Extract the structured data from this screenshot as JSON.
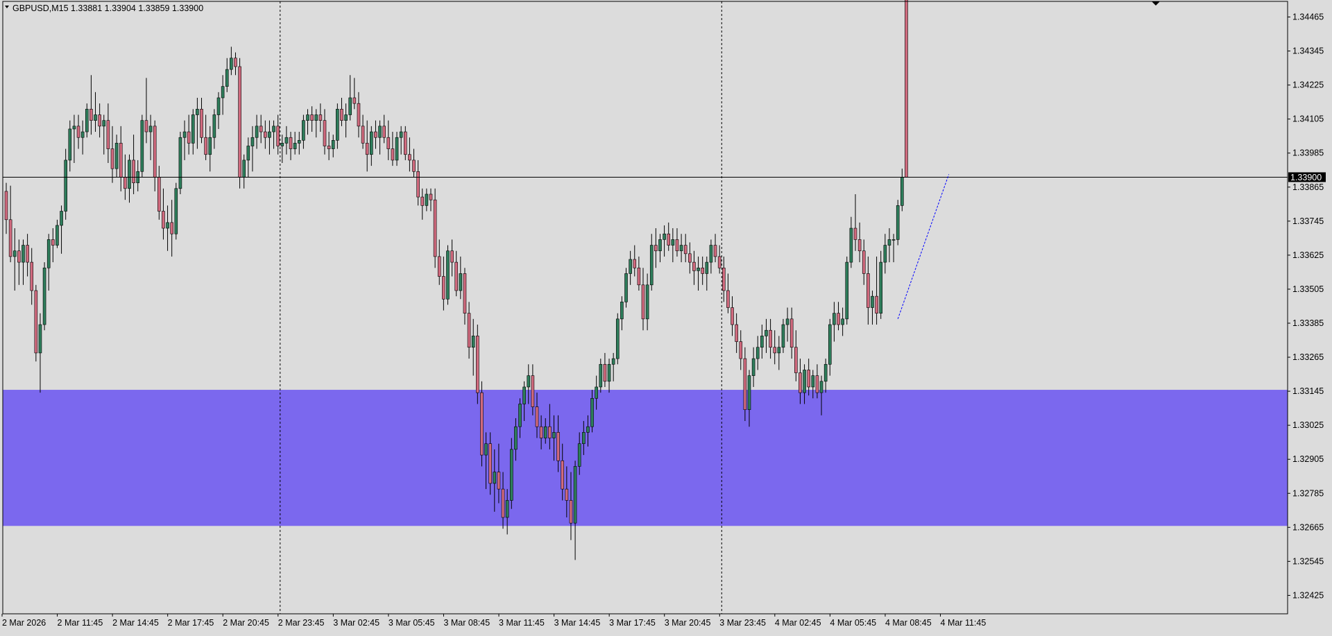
{
  "header": {
    "symbol_timeframe": "GBPUSD,M15",
    "ohlc": "1.33881 1.33904 1.33859 1.33900"
  },
  "colors": {
    "background": "#dcdcdc",
    "bull": "#2e7d5b",
    "bear": "#d06a7e",
    "candle_border": "#000000",
    "zone": "#7b68ee",
    "current_price_line": "#000000",
    "trend_line": "#0000ff"
  },
  "chart_data": {
    "type": "candlestick",
    "symbol": "GBPUSD",
    "timeframe": "M15",
    "current_price": "1.33900",
    "ylim": [
      1.3236,
      1.3452
    ],
    "y_ticks": [
      "1.34465",
      "1.34345",
      "1.34225",
      "1.34105",
      "1.33985",
      "1.33865",
      "1.33745",
      "1.33625",
      "1.33505",
      "1.33385",
      "1.33265",
      "1.33145",
      "1.33025",
      "1.32905",
      "1.32785",
      "1.32665",
      "1.32545",
      "1.32425"
    ],
    "x_ticks": [
      {
        "label": "2 Mar 2026",
        "index": 0
      },
      {
        "label": "2 Mar 11:45",
        "index": 13
      },
      {
        "label": "2 Mar 14:45",
        "index": 26
      },
      {
        "label": "2 Mar 17:45",
        "index": 39
      },
      {
        "label": "2 Mar 20:45",
        "index": 52
      },
      {
        "label": "2 Mar 23:45",
        "index": 65
      },
      {
        "label": "3 Mar 02:45",
        "index": 78
      },
      {
        "label": "3 Mar 05:45",
        "index": 91
      },
      {
        "label": "3 Mar 08:45",
        "index": 104
      },
      {
        "label": "3 Mar 11:45",
        "index": 117
      },
      {
        "label": "3 Mar 14:45",
        "index": 130
      },
      {
        "label": "3 Mar 17:45",
        "index": 143
      },
      {
        "label": "3 Mar 20:45",
        "index": 156
      },
      {
        "label": "3 Mar 23:45",
        "index": 169
      },
      {
        "label": "4 Mar 02:45",
        "index": 182
      },
      {
        "label": "4 Mar 05:45",
        "index": 195
      },
      {
        "label": "4 Mar 08:45",
        "index": 208
      },
      {
        "label": "4 Mar 11:45",
        "index": 221
      }
    ],
    "day_separators": [
      65,
      169
    ],
    "zone": {
      "top": 1.3315,
      "bottom": 1.3267
    },
    "trend_line": {
      "from": {
        "index": 210,
        "price": 1.334
      },
      "to": {
        "index": 222,
        "price": 1.3391
      }
    },
    "candles": [
      [
        1.3385,
        1.3388,
        1.337,
        1.3375
      ],
      [
        1.3375,
        1.3387,
        1.336,
        1.3362
      ],
      [
        1.3362,
        1.3372,
        1.335,
        1.3364
      ],
      [
        1.3364,
        1.3368,
        1.3352,
        1.336
      ],
      [
        1.336,
        1.3368,
        1.3352,
        1.3366
      ],
      [
        1.3366,
        1.337,
        1.3355,
        1.336
      ],
      [
        1.336,
        1.3365,
        1.3345,
        1.335
      ],
      [
        1.335,
        1.3352,
        1.3325,
        1.3328
      ],
      [
        1.3328,
        1.3342,
        1.3314,
        1.3338
      ],
      [
        1.3338,
        1.336,
        1.3336,
        1.3358
      ],
      [
        1.3358,
        1.337,
        1.335,
        1.3368
      ],
      [
        1.3368,
        1.3372,
        1.336,
        1.3366
      ],
      [
        1.3366,
        1.3375,
        1.3365,
        1.3373
      ],
      [
        1.3373,
        1.338,
        1.3363,
        1.3378
      ],
      [
        1.3378,
        1.34,
        1.3375,
        1.3396
      ],
      [
        1.3396,
        1.341,
        1.3392,
        1.3407
      ],
      [
        1.3407,
        1.3412,
        1.3395,
        1.3408
      ],
      [
        1.3408,
        1.3412,
        1.34,
        1.3404
      ],
      [
        1.3404,
        1.341,
        1.3398,
        1.3406
      ],
      [
        1.3406,
        1.3416,
        1.3404,
        1.3414
      ],
      [
        1.3414,
        1.3426,
        1.3405,
        1.341
      ],
      [
        1.341,
        1.342,
        1.3406,
        1.3412
      ],
      [
        1.3412,
        1.3416,
        1.3404,
        1.3408
      ],
      [
        1.3408,
        1.3412,
        1.3398,
        1.341
      ],
      [
        1.341,
        1.3416,
        1.3395,
        1.34
      ],
      [
        1.34,
        1.3408,
        1.3388,
        1.3393
      ],
      [
        1.3393,
        1.3405,
        1.339,
        1.3402
      ],
      [
        1.3402,
        1.3408,
        1.3385,
        1.339
      ],
      [
        1.339,
        1.3398,
        1.3382,
        1.3386
      ],
      [
        1.3386,
        1.3398,
        1.3381,
        1.3396
      ],
      [
        1.3396,
        1.3405,
        1.3384,
        1.3388
      ],
      [
        1.3388,
        1.3396,
        1.3385,
        1.3392
      ],
      [
        1.3392,
        1.3412,
        1.339,
        1.341
      ],
      [
        1.341,
        1.3425,
        1.3402,
        1.3406
      ],
      [
        1.3406,
        1.3412,
        1.3396,
        1.3408
      ],
      [
        1.3408,
        1.341,
        1.3385,
        1.339
      ],
      [
        1.339,
        1.3394,
        1.3375,
        1.3378
      ],
      [
        1.3378,
        1.3386,
        1.3368,
        1.3372
      ],
      [
        1.3372,
        1.338,
        1.3364,
        1.3374
      ],
      [
        1.3374,
        1.3382,
        1.3362,
        1.337
      ],
      [
        1.337,
        1.3388,
        1.3368,
        1.3386
      ],
      [
        1.3386,
        1.3406,
        1.3384,
        1.3404
      ],
      [
        1.3404,
        1.341,
        1.3396,
        1.3406
      ],
      [
        1.3406,
        1.3412,
        1.3398,
        1.3402
      ],
      [
        1.3402,
        1.3414,
        1.3398,
        1.3412
      ],
      [
        1.3412,
        1.3418,
        1.34,
        1.3414
      ],
      [
        1.3414,
        1.3418,
        1.3402,
        1.3404
      ],
      [
        1.3404,
        1.3412,
        1.3396,
        1.3398
      ],
      [
        1.3398,
        1.3408,
        1.3392,
        1.3404
      ],
      [
        1.3404,
        1.3414,
        1.34,
        1.3412
      ],
      [
        1.3412,
        1.342,
        1.3407,
        1.3418
      ],
      [
        1.3418,
        1.3426,
        1.3412,
        1.3422
      ],
      [
        1.3422,
        1.3432,
        1.342,
        1.3428
      ],
      [
        1.3428,
        1.3436,
        1.3426,
        1.3432
      ],
      [
        1.3432,
        1.3434,
        1.3426,
        1.3429
      ],
      [
        1.3429,
        1.3432,
        1.3386,
        1.339
      ],
      [
        1.339,
        1.3398,
        1.3386,
        1.3396
      ],
      [
        1.3396,
        1.3404,
        1.339,
        1.3401
      ],
      [
        1.3401,
        1.3408,
        1.3392,
        1.3404
      ],
      [
        1.3404,
        1.3412,
        1.34,
        1.3408
      ],
      [
        1.3408,
        1.3412,
        1.3402,
        1.3406
      ],
      [
        1.3406,
        1.341,
        1.34,
        1.3404
      ],
      [
        1.3404,
        1.341,
        1.3398,
        1.3406
      ],
      [
        1.3406,
        1.341,
        1.34,
        1.3408
      ],
      [
        1.3408,
        1.3412,
        1.3398,
        1.3401
      ],
      [
        1.3401,
        1.3405,
        1.3395,
        1.3402
      ],
      [
        1.3402,
        1.3408,
        1.3398,
        1.3404
      ],
      [
        1.3404,
        1.3406,
        1.3396,
        1.34
      ],
      [
        1.34,
        1.3406,
        1.3398,
        1.3402
      ],
      [
        1.3402,
        1.3406,
        1.3398,
        1.3403
      ],
      [
        1.3403,
        1.3412,
        1.34,
        1.341
      ],
      [
        1.341,
        1.3414,
        1.3405,
        1.3412
      ],
      [
        1.3412,
        1.3415,
        1.3406,
        1.341
      ],
      [
        1.341,
        1.3414,
        1.3404,
        1.3412
      ],
      [
        1.3412,
        1.3416,
        1.3406,
        1.341
      ],
      [
        1.341,
        1.3414,
        1.3398,
        1.3401
      ],
      [
        1.3401,
        1.3406,
        1.3396,
        1.34
      ],
      [
        1.34,
        1.3405,
        1.3397,
        1.3403
      ],
      [
        1.3403,
        1.3416,
        1.34,
        1.3414
      ],
      [
        1.3414,
        1.3418,
        1.3408,
        1.341
      ],
      [
        1.341,
        1.3416,
        1.3404,
        1.3412
      ],
      [
        1.3412,
        1.3426,
        1.341,
        1.3418
      ],
      [
        1.3418,
        1.3425,
        1.3414,
        1.3416
      ],
      [
        1.3416,
        1.342,
        1.3404,
        1.3408
      ],
      [
        1.3408,
        1.3412,
        1.34,
        1.3402
      ],
      [
        1.3402,
        1.341,
        1.3392,
        1.3398
      ],
      [
        1.3398,
        1.3408,
        1.3394,
        1.3406
      ],
      [
        1.3406,
        1.341,
        1.34,
        1.3404
      ],
      [
        1.3404,
        1.341,
        1.3398,
        1.3408
      ],
      [
        1.3408,
        1.3412,
        1.3402,
        1.3404
      ],
      [
        1.3404,
        1.341,
        1.3396,
        1.34
      ],
      [
        1.34,
        1.3406,
        1.3394,
        1.3396
      ],
      [
        1.3396,
        1.3406,
        1.3394,
        1.3404
      ],
      [
        1.3404,
        1.3408,
        1.3398,
        1.3406
      ],
      [
        1.3406,
        1.3408,
        1.3396,
        1.3398
      ],
      [
        1.3398,
        1.3404,
        1.3392,
        1.3396
      ],
      [
        1.3396,
        1.34,
        1.339,
        1.3392
      ],
      [
        1.3392,
        1.3396,
        1.338,
        1.3383
      ],
      [
        1.3383,
        1.3386,
        1.3375,
        1.338
      ],
      [
        1.338,
        1.3386,
        1.3378,
        1.3384
      ],
      [
        1.3384,
        1.3386,
        1.3378,
        1.3382
      ],
      [
        1.3382,
        1.3386,
        1.3358,
        1.3362
      ],
      [
        1.3362,
        1.3368,
        1.3352,
        1.3355
      ],
      [
        1.3355,
        1.3362,
        1.3343,
        1.3347
      ],
      [
        1.3347,
        1.3366,
        1.3345,
        1.3364
      ],
      [
        1.3364,
        1.3368,
        1.3355,
        1.336
      ],
      [
        1.336,
        1.3364,
        1.3348,
        1.335
      ],
      [
        1.335,
        1.3362,
        1.3347,
        1.3356
      ],
      [
        1.3356,
        1.3358,
        1.3338,
        1.3342
      ],
      [
        1.3342,
        1.3346,
        1.3326,
        1.333
      ],
      [
        1.333,
        1.334,
        1.332,
        1.3334
      ],
      [
        1.3334,
        1.3338,
        1.331,
        1.3314
      ],
      [
        1.3314,
        1.3318,
        1.3288,
        1.3292
      ],
      [
        1.3292,
        1.33,
        1.328,
        1.3296
      ],
      [
        1.3296,
        1.33,
        1.3278,
        1.3282
      ],
      [
        1.3282,
        1.3294,
        1.3272,
        1.3286
      ],
      [
        1.3286,
        1.3296,
        1.3275,
        1.328
      ],
      [
        1.328,
        1.3286,
        1.3266,
        1.327
      ],
      [
        1.327,
        1.328,
        1.3264,
        1.3276
      ],
      [
        1.3276,
        1.3298,
        1.3273,
        1.3294
      ],
      [
        1.3294,
        1.3305,
        1.329,
        1.3302
      ],
      [
        1.3302,
        1.3312,
        1.3298,
        1.331
      ],
      [
        1.331,
        1.3318,
        1.3304,
        1.3316
      ],
      [
        1.3316,
        1.3324,
        1.331,
        1.332
      ],
      [
        1.332,
        1.3324,
        1.3306,
        1.3309
      ],
      [
        1.3309,
        1.3314,
        1.3298,
        1.3302
      ],
      [
        1.3302,
        1.3306,
        1.3294,
        1.3298
      ],
      [
        1.3298,
        1.3305,
        1.3296,
        1.3302
      ],
      [
        1.3302,
        1.331,
        1.3294,
        1.3298
      ],
      [
        1.3298,
        1.3306,
        1.329,
        1.33
      ],
      [
        1.33,
        1.3306,
        1.3286,
        1.329
      ],
      [
        1.329,
        1.3296,
        1.3276,
        1.328
      ],
      [
        1.328,
        1.3288,
        1.327,
        1.3276
      ],
      [
        1.3276,
        1.3286,
        1.3262,
        1.3268
      ],
      [
        1.3268,
        1.329,
        1.3255,
        1.3288
      ],
      [
        1.3288,
        1.33,
        1.3285,
        1.3296
      ],
      [
        1.3296,
        1.3304,
        1.3292,
        1.33
      ],
      [
        1.33,
        1.3306,
        1.3295,
        1.3302
      ],
      [
        1.3302,
        1.3315,
        1.33,
        1.3312
      ],
      [
        1.3312,
        1.332,
        1.3308,
        1.3316
      ],
      [
        1.3316,
        1.3326,
        1.3314,
        1.3324
      ],
      [
        1.3324,
        1.3328,
        1.3316,
        1.3318
      ],
      [
        1.3318,
        1.3326,
        1.3314,
        1.3324
      ],
      [
        1.3324,
        1.3328,
        1.3318,
        1.3326
      ],
      [
        1.3326,
        1.3342,
        1.3324,
        1.334
      ],
      [
        1.334,
        1.3348,
        1.3336,
        1.3346
      ],
      [
        1.3346,
        1.3358,
        1.3344,
        1.3356
      ],
      [
        1.3356,
        1.3364,
        1.3352,
        1.3361
      ],
      [
        1.3361,
        1.3366,
        1.3355,
        1.3358
      ],
      [
        1.3358,
        1.3362,
        1.335,
        1.3352
      ],
      [
        1.3352,
        1.3358,
        1.3336,
        1.334
      ],
      [
        1.334,
        1.3356,
        1.3336,
        1.3352
      ],
      [
        1.3352,
        1.337,
        1.335,
        1.3366
      ],
      [
        1.3366,
        1.3372,
        1.3358,
        1.3364
      ],
      [
        1.3364,
        1.337,
        1.336,
        1.3368
      ],
      [
        1.3368,
        1.3373,
        1.3362,
        1.337
      ],
      [
        1.337,
        1.3374,
        1.3364,
        1.3366
      ],
      [
        1.3366,
        1.3372,
        1.336,
        1.3368
      ],
      [
        1.3368,
        1.3372,
        1.3362,
        1.3364
      ],
      [
        1.3364,
        1.337,
        1.336,
        1.3366
      ],
      [
        1.3366,
        1.337,
        1.336,
        1.3363
      ],
      [
        1.3363,
        1.3367,
        1.3356,
        1.336
      ],
      [
        1.336,
        1.3364,
        1.3352,
        1.3357
      ],
      [
        1.3357,
        1.3362,
        1.335,
        1.3358
      ],
      [
        1.3358,
        1.3362,
        1.3352,
        1.3356
      ],
      [
        1.3356,
        1.3362,
        1.335,
        1.336
      ],
      [
        1.336,
        1.3368,
        1.3356,
        1.3366
      ],
      [
        1.3366,
        1.337,
        1.336,
        1.3362
      ],
      [
        1.3362,
        1.3366,
        1.3356,
        1.3358
      ],
      [
        1.3358,
        1.3362,
        1.3346,
        1.335
      ],
      [
        1.335,
        1.3356,
        1.3342,
        1.3344
      ],
      [
        1.3344,
        1.3348,
        1.3334,
        1.3338
      ],
      [
        1.3338,
        1.3342,
        1.3328,
        1.3332
      ],
      [
        1.3332,
        1.3336,
        1.3322,
        1.3326
      ],
      [
        1.3326,
        1.333,
        1.3304,
        1.3308
      ],
      [
        1.3308,
        1.3322,
        1.3302,
        1.332
      ],
      [
        1.332,
        1.333,
        1.3316,
        1.3326
      ],
      [
        1.3326,
        1.3334,
        1.3322,
        1.333
      ],
      [
        1.333,
        1.3338,
        1.3326,
        1.3334
      ],
      [
        1.3334,
        1.334,
        1.3328,
        1.3336
      ],
      [
        1.3336,
        1.334,
        1.3326,
        1.333
      ],
      [
        1.333,
        1.3336,
        1.3324,
        1.3328
      ],
      [
        1.3328,
        1.3334,
        1.3322,
        1.333
      ],
      [
        1.333,
        1.334,
        1.3328,
        1.3338
      ],
      [
        1.3338,
        1.3344,
        1.3332,
        1.334
      ],
      [
        1.334,
        1.3344,
        1.3326,
        1.333
      ],
      [
        1.333,
        1.3336,
        1.3318,
        1.3321
      ],
      [
        1.3321,
        1.3326,
        1.331,
        1.3314
      ],
      [
        1.3314,
        1.3324,
        1.331,
        1.3322
      ],
      [
        1.3322,
        1.3326,
        1.3313,
        1.3316
      ],
      [
        1.3316,
        1.3322,
        1.3312,
        1.332
      ],
      [
        1.332,
        1.3324,
        1.3312,
        1.3314
      ],
      [
        1.3314,
        1.332,
        1.3306,
        1.3318
      ],
      [
        1.3318,
        1.3326,
        1.3314,
        1.3324
      ],
      [
        1.3324,
        1.334,
        1.332,
        1.3338
      ],
      [
        1.3338,
        1.3346,
        1.3332,
        1.3342
      ],
      [
        1.3342,
        1.3346,
        1.3336,
        1.3338
      ],
      [
        1.3338,
        1.3344,
        1.3334,
        1.334
      ],
      [
        1.334,
        1.3362,
        1.3338,
        1.336
      ],
      [
        1.336,
        1.3376,
        1.3358,
        1.3372
      ],
      [
        1.3372,
        1.3384,
        1.3364,
        1.3368
      ],
      [
        1.3368,
        1.3374,
        1.336,
        1.3364
      ],
      [
        1.3364,
        1.3368,
        1.3352,
        1.3356
      ],
      [
        1.3356,
        1.3362,
        1.3338,
        1.3344
      ],
      [
        1.3344,
        1.335,
        1.3338,
        1.3348
      ],
      [
        1.3348,
        1.3362,
        1.3338,
        1.3342
      ],
      [
        1.3342,
        1.3364,
        1.334,
        1.336
      ],
      [
        1.336,
        1.337,
        1.3356,
        1.3366
      ],
      [
        1.3366,
        1.3372,
        1.336,
        1.3368
      ],
      [
        1.3368,
        1.337,
        1.336,
        1.3368
      ],
      [
        1.3368,
        1.3382,
        1.3366,
        1.338
      ],
      [
        1.338,
        1.3393,
        1.3378,
        1.339
      ],
      [
        1.3881,
        1.3904,
        1.3859,
        1.339
      ]
    ]
  }
}
